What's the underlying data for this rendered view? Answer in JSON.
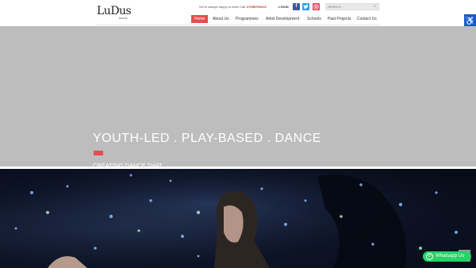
{
  "header": {
    "logo_text": "LuDus",
    "logo_sub": "DANCE",
    "tagline": "We're always happy to chat! Call:",
    "phone": "07598766915",
    "login": "LOGIN",
    "social": [
      "f",
      "t",
      "ig"
    ],
    "search_placeholder": "SEARCH ...",
    "nav": [
      "Home",
      "About Us",
      "Programmes",
      "Artist Development",
      "Schools",
      "Past Projects",
      "Contact Us"
    ],
    "active_nav": "Home"
  },
  "hero": {
    "title": "YOUTH-LED . PLAY-BASED . DANCE",
    "subtitle": "CREATING DANCE THAT MATTERS",
    "accent_color": "#e74c4c",
    "background_color": "#bdbdbd"
  },
  "whatsapp": {
    "label": "Whatsapp Us",
    "color": "#25d366"
  },
  "accessibility_icon": "accessibility-icon"
}
